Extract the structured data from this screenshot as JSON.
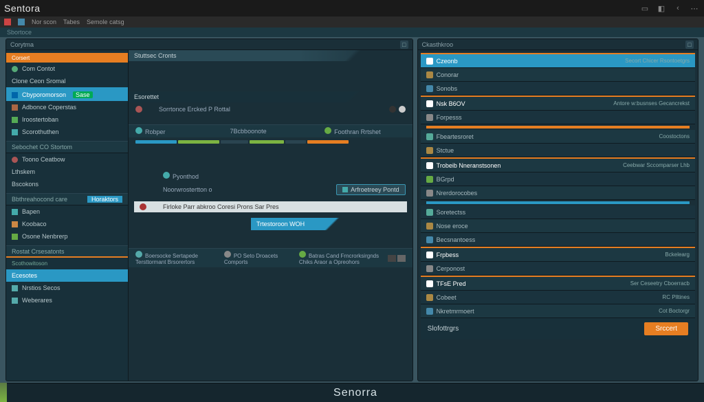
{
  "app": {
    "name": "Sentora"
  },
  "menu": {
    "items": [
      "Nor scon",
      "Tabes",
      "Semole catsg"
    ]
  },
  "toolbar": {
    "label": "Sbortoce"
  },
  "leftPanel": {
    "title": "Corytma",
    "sidebar": {
      "accent": "Corsert",
      "items": [
        {
          "label": "Com Contot",
          "icon": "circle"
        },
        {
          "label": "Clone Ceon Sromal",
          "icon": "none"
        },
        {
          "label": "Cbyporomorson",
          "badge": "Sase",
          "selected": true
        },
        {
          "label": "Adbonce Coperstas",
          "icon": "sq"
        },
        {
          "label": "Iroostertoban",
          "icon": "sq-green"
        },
        {
          "label": "Scorothuthen",
          "icon": "sq-teal"
        }
      ],
      "section2": "Sebochet CO Stortom",
      "items2": [
        {
          "label": "Toono Ceatbow",
          "icon": "circle"
        },
        {
          "label": "Lthskem",
          "icon": "none"
        },
        {
          "label": "Bscokons",
          "icon": "none"
        }
      ],
      "section3": "Bbthreahocond care",
      "tag3": "Horaktors",
      "items3": [
        {
          "label": "Bapen",
          "icon": "sq-teal"
        },
        {
          "label": "Koobaco",
          "icon": "sq-orange"
        },
        {
          "label": "Osone Nenbrerp",
          "icon": "sq-green"
        }
      ],
      "section4": "Rostat Crsesatonts",
      "section5": "Scothowitoson",
      "item5": "Ecesotes",
      "tag5": "Trtestoroon WOH",
      "items6": [
        {
          "label": "Nrstios Secos"
        },
        {
          "label": "Weberares"
        }
      ]
    },
    "main": {
      "sec1": "Stuttsec Cronts",
      "sec2": "Esorettet",
      "row2": "Sorrtonce Ercked P Rottal",
      "tableCols": [
        "Robper",
        "7Bcbboonote",
        "Foothran Rrtshet"
      ],
      "sec3": "Pyonthod",
      "sec3b": "Noorwrostertton o",
      "chip": "Arfroetreey Pontd",
      "sec4": "Firloke Parr abkroo Coresi Prons Sar Pres",
      "footrow": [
        "Boersocke Sertapede Tersttormant Brsorertors",
        "PO Seto Droacets Comports",
        "Batras Cand Frncrorksirgnds Chiks Araor a Opreohors"
      ]
    }
  },
  "rightPanel": {
    "title": "Ckasthkroo",
    "rows": [
      {
        "label": "Czeonb",
        "hl": true,
        "rlabel": "Secort Chicer",
        "rlabel2": "Rsontoetgrs"
      },
      {
        "label": "Conorar"
      },
      {
        "label": "Sonobs"
      },
      {
        "label": "Nsk B6OV",
        "hl": true,
        "rlabel": "Antore w:busnses Gecancrekst"
      },
      {
        "label": "Forpesss",
        "bar": "orange"
      },
      {
        "label": "Fbeartesroret",
        "rlabel": "Coostoctons"
      },
      {
        "label": "Stctue"
      },
      {
        "label": "Trobeib    Nneranstsonen",
        "hl": true,
        "rlabel": "Ceebwar Sccomparser Lhb"
      },
      {
        "label": "BGrpd"
      },
      {
        "label": "Nrerdorocobes",
        "bar": "teal"
      },
      {
        "label": "Soretectss"
      },
      {
        "label": "Nose eroce"
      },
      {
        "label": "Becsnantoess"
      },
      {
        "label": "Frpbess",
        "hl": true,
        "rlabel": "Bckelearg"
      },
      {
        "label": "Cerponost"
      },
      {
        "label": "TFsE Pred",
        "hl": true,
        "rlabel": "Ser Ceseetry Cboerracb"
      },
      {
        "label": "Cobeet",
        "rlabel": "RC Plltines"
      },
      {
        "label": "Nkretmrmoert",
        "rlabel": "Cot Boctorgr"
      }
    ],
    "footLabel": "Slofottrgrs",
    "button": "Srccert"
  },
  "footer": {
    "brand": "Senorra"
  }
}
